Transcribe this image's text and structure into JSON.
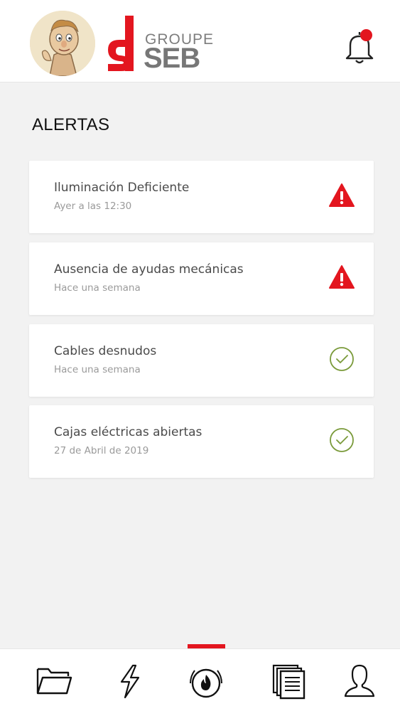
{
  "header": {
    "brand_groupe": "GROUPE",
    "brand_seb": "SEB",
    "avatar_icon": "mascot-avatar",
    "notification_icon": "bell-icon",
    "notification_badge_color": "#e3161f"
  },
  "main": {
    "title": "ALERTAS"
  },
  "alerts": [
    {
      "title": "Iluminación Deficiente",
      "time": "Ayer a las 12:30",
      "status": "warning",
      "icon": "warning-icon"
    },
    {
      "title": "Ausencia de ayudas mecánicas",
      "time": "Hace una semana",
      "status": "warning",
      "icon": "warning-icon"
    },
    {
      "title": "Cables desnudos",
      "time": "Hace una semana",
      "status": "resolved",
      "icon": "check-circle-icon"
    },
    {
      "title": "Cajas eléctricas abiertas",
      "time": "27 de Abril de 2019",
      "status": "resolved",
      "icon": "check-circle-icon"
    }
  ],
  "bottom_nav": {
    "items": [
      {
        "icon": "folder-icon",
        "active": false
      },
      {
        "icon": "lightning-icon",
        "active": false
      },
      {
        "icon": "fire-alarm-icon",
        "active": true
      },
      {
        "icon": "documents-icon",
        "active": false
      },
      {
        "icon": "user-icon",
        "active": false
      }
    ]
  },
  "colors": {
    "accent": "#e3161f",
    "warning": "#e3161f",
    "success": "#7a9a3a",
    "background": "#f2f2f2"
  }
}
